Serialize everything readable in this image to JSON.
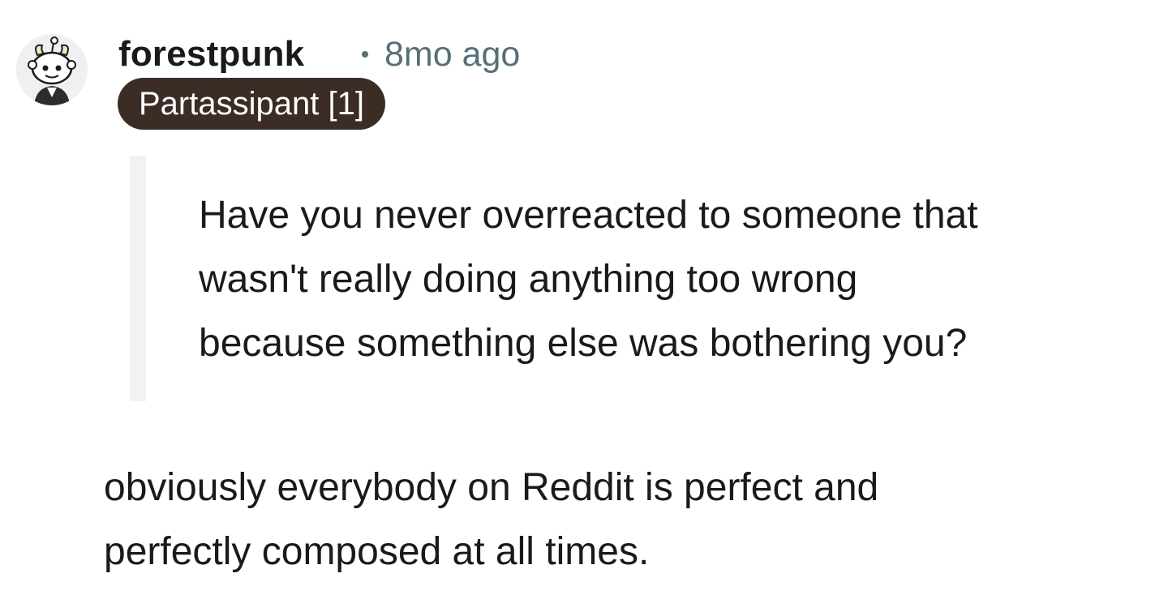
{
  "comment": {
    "author": "forestpunk",
    "timestamp": "8mo ago",
    "flair": "Partassipant [1]",
    "quote_lines": [
      "Have you never overreacted to someone that",
      "wasn't really doing anything too wrong",
      "because something else was bothering you?"
    ],
    "body_lines": [
      "obviously everybody on Reddit is perfect and",
      "perfectly composed at all times."
    ]
  },
  "colors": {
    "flair_background": "#3b2c26",
    "flair_text": "#ffffff",
    "meta_text": "#576f76",
    "quote_bar": "#f2f2f2",
    "avatar_background": "#eef0f2"
  },
  "icons": {
    "avatar": "snoo-avatar-icon"
  }
}
